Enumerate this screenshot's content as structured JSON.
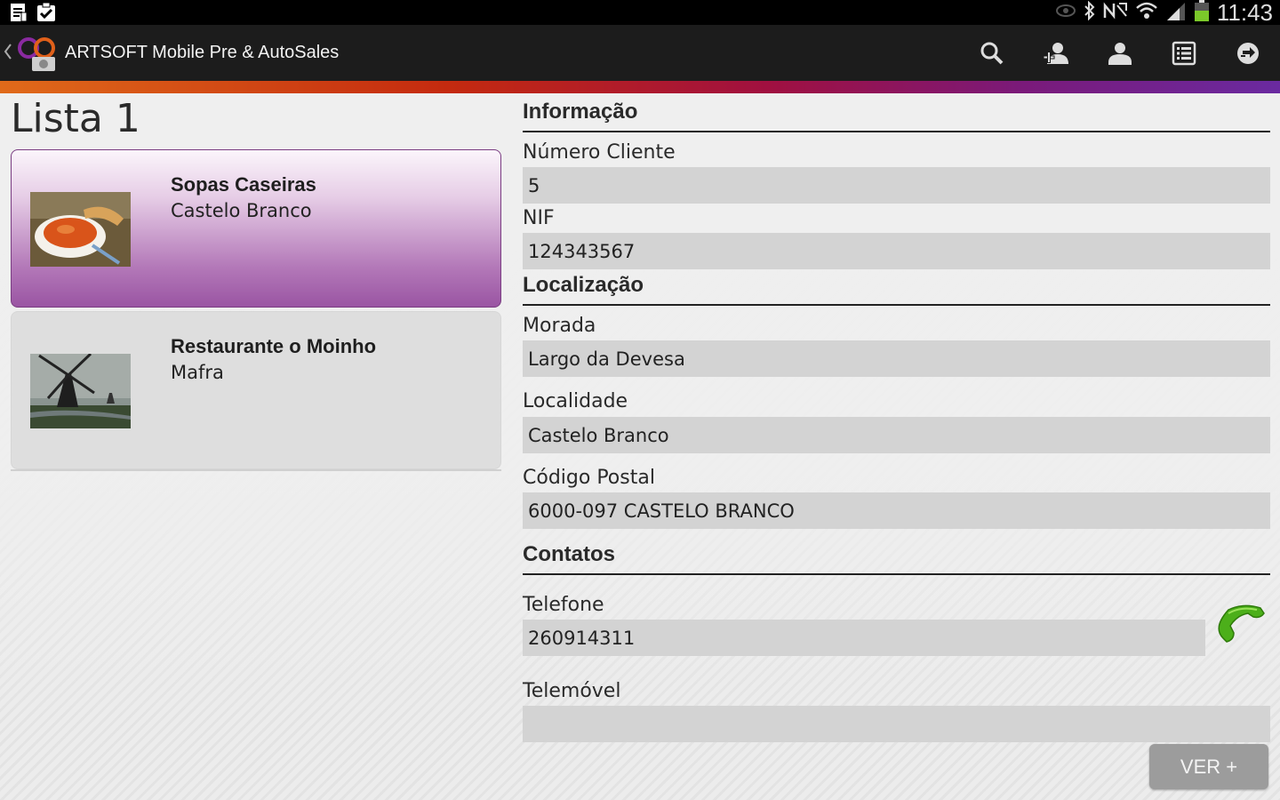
{
  "status_bar": {
    "time": "11:43",
    "left_icons": [
      "notes-icon",
      "task-check-icon"
    ],
    "right_icons": [
      "eye-icon",
      "bluetooth-icon",
      "nfc-icon",
      "wifi-icon",
      "signal-icon",
      "battery-icon"
    ]
  },
  "action_bar": {
    "title": "ARTSOFT Mobile Pre & AutoSales",
    "actions": [
      "search-icon",
      "add-contact-icon",
      "contact-icon",
      "list-view-icon",
      "sync-icon"
    ]
  },
  "list": {
    "title": "Lista 1",
    "items": [
      {
        "name": "Sopas Caseiras",
        "city": "Castelo Branco",
        "selected": true,
        "thumbnail": "soup-photo"
      },
      {
        "name": "Restaurante o Moinho",
        "city": "Mafra",
        "selected": false,
        "thumbnail": "windmill-photo"
      }
    ]
  },
  "details": {
    "sections": {
      "info": "Informação",
      "location": "Localização",
      "contacts": "Contatos"
    },
    "fields": {
      "client_number": {
        "label": "Número Cliente",
        "value": "5"
      },
      "nif": {
        "label": "NIF",
        "value": "124343567"
      },
      "address": {
        "label": "Morada",
        "value": "Largo da Devesa"
      },
      "locality": {
        "label": "Localidade",
        "value": "Castelo Branco"
      },
      "postal_code": {
        "label": "Código Postal",
        "value": "6000-097 CASTELO BRANCO"
      },
      "phone": {
        "label": "Telefone",
        "value": "260914311"
      },
      "mobile": {
        "label": "Telemóvel",
        "value": ""
      }
    },
    "more_button": "VER +"
  },
  "colors": {
    "accent_purple": "#9a55a3",
    "call_green": "#4caf1a"
  }
}
